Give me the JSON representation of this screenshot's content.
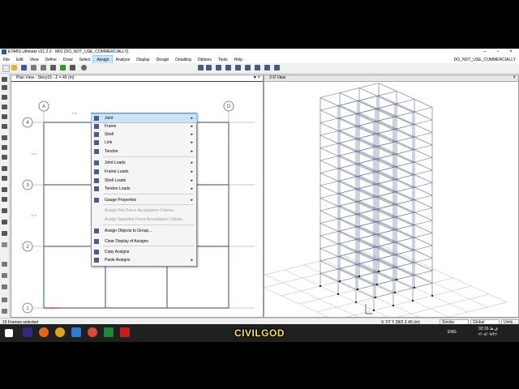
{
  "app": {
    "title": "ETABS Ultimate v21.2.0 - M01  [DO_NOT_USE_COMMERCIALLY]",
    "project_label": "DO_NOT_USE_COMMERCIALLY",
    "window_buttons": {
      "minimize": "–",
      "maximize": "▫",
      "close": "×"
    }
  },
  "menubar": {
    "items": [
      "File",
      "Edit",
      "View",
      "Define",
      "Draw",
      "Select",
      "Assign",
      "Analyze",
      "Display",
      "Design",
      "Detailing",
      "Options",
      "Tools",
      "Help"
    ],
    "active": "Assign"
  },
  "panes": {
    "plan": {
      "title": "Plan View - Story15 - Z = 45 (m)",
      "close": "×",
      "pin": "▾"
    },
    "view3d": {
      "title": "3-D View",
      "close": "×"
    }
  },
  "grid_labels": {
    "columns": [
      "A",
      "D"
    ],
    "rows": [
      "4",
      "3",
      "2",
      "1"
    ],
    "spans": [
      "8 m",
      "8 m",
      "8 m"
    ]
  },
  "assign_menu": {
    "items": [
      {
        "label": "Joint",
        "submenu": true,
        "highlighted": true,
        "icon": "joint-icon"
      },
      {
        "label": "Frame",
        "submenu": true,
        "icon": "frame-icon"
      },
      {
        "label": "Shell",
        "submenu": true,
        "icon": "shell-icon"
      },
      {
        "label": "Link",
        "submenu": true,
        "icon": "link-icon"
      },
      {
        "label": "Tendon",
        "submenu": true,
        "icon": "tendon-icon"
      },
      {
        "label": "Joint Loads",
        "submenu": true,
        "icon": "joint-loads-icon"
      },
      {
        "label": "Frame Loads",
        "submenu": true,
        "icon": "frame-loads-icon"
      },
      {
        "label": "Shell Loads",
        "submenu": true,
        "icon": "shell-loads-icon"
      },
      {
        "label": "Tendon Loads",
        "submenu": true,
        "icon": "tendon-loads-icon"
      },
      {
        "label": "Gauge Properties",
        "submenu": true,
        "icon": "gauge-icon"
      },
      {
        "label": "Assign Pier Force Acceptance Criteria...",
        "disabled": true
      },
      {
        "label": "Assign Spandrel Force Acceptance Criteria...",
        "disabled": true
      },
      {
        "label": "Assign Objects to Group...",
        "icon": "group-icon"
      },
      {
        "label": "Clear Display of Assigns",
        "icon": "clear-icon"
      },
      {
        "label": "Copy Assigns",
        "icon": "copy-icon"
      },
      {
        "label": "Paste Assigns",
        "submenu": true,
        "icon": "paste-icon"
      }
    ]
  },
  "status": {
    "selection": "15 Frames selected",
    "coords": "X 7/7  Y 28/2  Z 45 (m)",
    "stories": "Similar Stories",
    "coord_sys": "Global",
    "units": "Units..."
  },
  "caption": "CIVILGOD",
  "taskbar": {
    "tray_lang": "ENG",
    "time": "02:16 ق.ظ",
    "date": "۲/۰۸/۰۹/۲۲"
  },
  "colors": {
    "structure_line": "#5a6a8a",
    "grid_line": "#b8b8b8",
    "menu_highlight": "#cce4f7",
    "caption": "#ffe14d"
  }
}
